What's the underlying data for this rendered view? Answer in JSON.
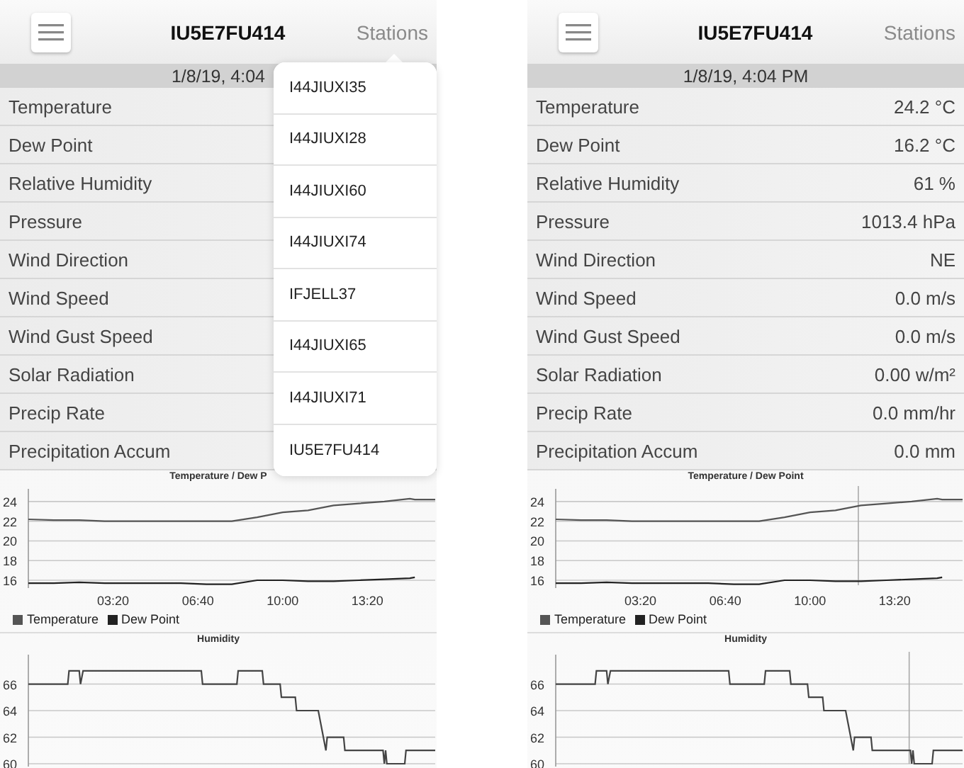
{
  "phones": [
    {
      "header": {
        "title": "IU5E7FU414",
        "stations": "Stations"
      },
      "date": "1/8/19, 4:04",
      "rows": [
        {
          "label": "Temperature"
        },
        {
          "label": "Dew Point"
        },
        {
          "label": "Relative Humidity"
        },
        {
          "label": "Pressure"
        },
        {
          "label": "Wind Direction"
        },
        {
          "label": "Wind Speed"
        },
        {
          "label": "Wind Gust Speed"
        },
        {
          "label": "Solar Radiation"
        },
        {
          "label": "Precip Rate"
        },
        {
          "label": "Precipitation Accum"
        }
      ],
      "dropdown": {
        "items": [
          {
            "label": "I44JIUXI35",
            "selected": false
          },
          {
            "label": "I44JIUXI28",
            "selected": false
          },
          {
            "label": "I44JIUXI60",
            "selected": false
          },
          {
            "label": "I44JIUXI74",
            "selected": false
          },
          {
            "label": "IFJELL37",
            "selected": false
          },
          {
            "label": "I44JIUXI65",
            "selected": false
          },
          {
            "label": "I44JIUXI71",
            "selected": false
          },
          {
            "label": "IU5E7FU414",
            "selected": false
          }
        ]
      },
      "temp_chart": {
        "chart_data": {
          "type": "line",
          "title": "Temperature / Dew P",
          "x": [
            0,
            1,
            2,
            3,
            4,
            5,
            6,
            7,
            8,
            9,
            10,
            11,
            12,
            13,
            14,
            15,
            15.2,
            16
          ],
          "series": [
            {
              "name": "Temperature",
              "color": "#555555",
              "values": [
                22.2,
                22.1,
                22.1,
                22.0,
                22.0,
                22.0,
                22.0,
                22.0,
                22.0,
                22.4,
                22.9,
                23.1,
                23.6,
                23.8,
                24.0,
                24.3,
                24.2,
                24.2
              ]
            },
            {
              "name": "Dew Point",
              "color": "#222222",
              "values": [
                15.7,
                15.7,
                15.8,
                15.7,
                15.7,
                15.7,
                15.7,
                15.6,
                15.6,
                16.0,
                16.0,
                15.9,
                15.9,
                16.0,
                16.1,
                16.2,
                16.3,
                null
              ]
            }
          ],
          "xlim": [
            0,
            16
          ],
          "ylim": [
            15.5,
            25
          ],
          "xticks": [
            {
              "value": 3.333,
              "label": "03:20"
            },
            {
              "value": 6.667,
              "label": "06:40"
            },
            {
              "value": 10,
              "label": "10:00"
            },
            {
              "value": 13.333,
              "label": "13:20"
            }
          ],
          "yticks": [
            16,
            18,
            20,
            22,
            24
          ],
          "grid": true
        }
      },
      "humidity_chart": {
        "chart_data": {
          "type": "line",
          "title": "Humidity",
          "x": [
            0,
            1.55,
            1.6,
            2.0,
            2.05,
            2.15,
            6.8,
            6.85,
            8.2,
            8.25,
            9.2,
            9.25,
            9.9,
            9.95,
            10.5,
            10.55,
            11.4,
            11.5,
            11.7,
            11.75,
            12.4,
            12.45,
            13.95,
            14.0,
            14.05,
            14.1,
            14.8,
            14.85,
            16
          ],
          "series": [
            {
              "color": "#444444",
              "values": [
                66,
                66,
                67,
                67,
                66,
                67,
                67,
                66,
                66,
                67,
                67,
                66,
                66,
                65,
                65,
                64,
                64,
                63,
                61,
                62,
                62,
                61,
                61,
                60,
                61,
                60,
                60,
                61,
                61
              ]
            }
          ],
          "xlim": [
            0,
            16
          ],
          "ylim": [
            60,
            68
          ],
          "yticks": [
            60,
            62,
            64,
            66
          ],
          "grid": true
        }
      }
    },
    {
      "header": {
        "title": "IU5E7FU414",
        "stations": "Stations"
      },
      "date": "1/8/19, 4:04 PM",
      "rows": [
        {
          "label": "Temperature",
          "value": "24.2 °C"
        },
        {
          "label": "Dew Point",
          "value": "16.2 °C"
        },
        {
          "label": "Relative Humidity",
          "value": "61 %"
        },
        {
          "label": "Pressure",
          "value": "1013.4 hPa"
        },
        {
          "label": "Wind Direction",
          "value": "NE"
        },
        {
          "label": "Wind Speed",
          "value": "0.0 m/s"
        },
        {
          "label": "Wind Gust Speed",
          "value": "0.0 m/s"
        },
        {
          "label": "Solar Radiation",
          "value": "0.00 w/m²"
        },
        {
          "label": "Precip Rate",
          "value": "0.0 mm/hr"
        },
        {
          "label": "Precipitation Accum",
          "value": "0.0 mm"
        }
      ],
      "temp_chart": {
        "chart_data": {
          "type": "line",
          "title": "Temperature / Dew Point",
          "x": [
            0,
            1,
            2,
            3,
            4,
            5,
            6,
            7,
            8,
            9,
            10,
            11,
            12,
            13,
            14,
            15,
            15.2,
            16
          ],
          "series": [
            {
              "name": "Temperature",
              "color": "#555555",
              "values": [
                22.2,
                22.1,
                22.1,
                22.0,
                22.0,
                22.0,
                22.0,
                22.0,
                22.0,
                22.4,
                22.9,
                23.1,
                23.6,
                23.8,
                24.0,
                24.3,
                24.2,
                24.2
              ]
            },
            {
              "name": "Dew Point",
              "color": "#222222",
              "values": [
                15.7,
                15.7,
                15.8,
                15.7,
                15.7,
                15.7,
                15.7,
                15.6,
                15.6,
                16.0,
                16.0,
                15.9,
                15.9,
                16.0,
                16.1,
                16.2,
                16.3,
                null
              ]
            }
          ],
          "xlim": [
            0,
            16
          ],
          "ylim": [
            15.5,
            25
          ],
          "xticks": [
            {
              "value": 3.333,
              "label": "03:20"
            },
            {
              "value": 6.667,
              "label": "06:40"
            },
            {
              "value": 10,
              "label": "10:00"
            },
            {
              "value": 13.333,
              "label": "13:20"
            }
          ],
          "yticks": [
            16,
            18,
            20,
            22,
            24
          ],
          "grid": true,
          "ref_lines": [
            {
              "axis": "x",
              "value": 11.9
            }
          ]
        }
      },
      "humidity_chart": {
        "chart_data": {
          "type": "line",
          "title": "Humidity",
          "x": [
            0,
            1.55,
            1.6,
            2.0,
            2.05,
            2.15,
            6.8,
            6.85,
            8.2,
            8.25,
            9.2,
            9.25,
            9.9,
            9.95,
            10.5,
            10.55,
            11.4,
            11.5,
            11.7,
            11.75,
            12.4,
            12.45,
            13.95,
            14.0,
            14.05,
            14.1,
            14.8,
            14.85,
            16
          ],
          "series": [
            {
              "color": "#444444",
              "values": [
                66,
                66,
                67,
                67,
                66,
                67,
                67,
                66,
                66,
                67,
                67,
                66,
                66,
                65,
                65,
                64,
                64,
                63,
                61,
                62,
                62,
                61,
                61,
                60,
                61,
                60,
                60,
                61,
                61
              ]
            }
          ],
          "xlim": [
            0,
            16
          ],
          "ylim": [
            60,
            68
          ],
          "yticks": [
            60,
            62,
            64,
            66
          ],
          "grid": true,
          "ref_lines": [
            {
              "axis": "x",
              "value": 13.9
            }
          ]
        }
      }
    }
  ]
}
